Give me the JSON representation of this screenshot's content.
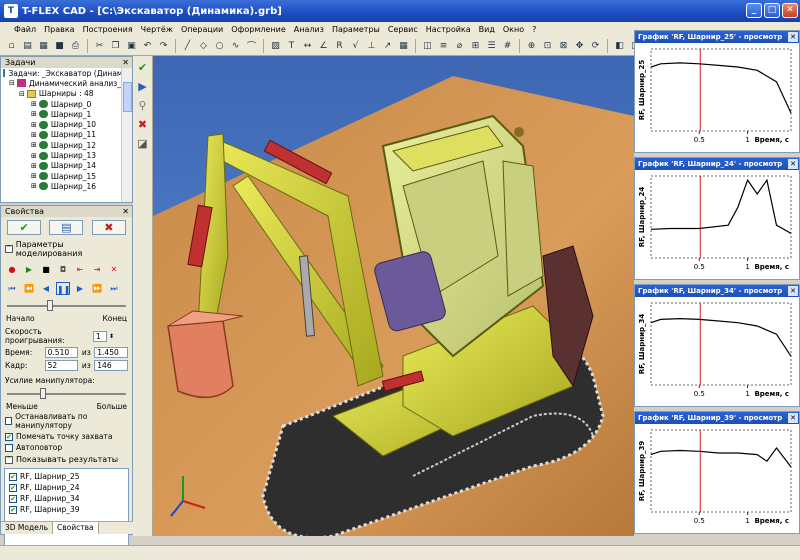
{
  "window": {
    "title": "T-FLEX CAD - [C:\\Экскаватор (Динамика).grb]",
    "app_icon": "tflex-logo-icon"
  },
  "menu": [
    "Файл",
    "Правка",
    "Построения",
    "Чертёж",
    "Операции",
    "Оформление",
    "Анализ",
    "Параметры",
    "Сервис",
    "Настройка",
    "Вид",
    "Окно",
    "?"
  ],
  "tasks_panel": {
    "title": "Задачи",
    "root": "Задачи: _Экскаватор (Динамик",
    "analysis": "Динамический анализ_0",
    "joints_folder": "Шарниры : 48",
    "joints": [
      "Шарнир_0",
      "Шарнир_1",
      "Шарнир_10",
      "Шарнир_11",
      "Шарнир_12",
      "Шарнир_13",
      "Шарнир_14",
      "Шарнир_15",
      "Шарнир_16"
    ]
  },
  "properties_panel": {
    "title": "Свойства",
    "section_sim": "Параметры моделирования",
    "start_label": "Начало",
    "end_label": "Конец",
    "speed_label": "Скорость проигрывания:",
    "speed_value": "1",
    "time_label": "Время:",
    "time_value": "0.510",
    "time_of": "из",
    "time_total": "1.450",
    "frame_label": "Кадр:",
    "frame_value": "52",
    "frame_of": "из",
    "frame_total": "146",
    "manip_label": "Усилие манипулятора:",
    "less_label": "Меньше",
    "more_label": "Больше",
    "stop_by_manip": "Останавливать по манипулятору",
    "mark_grip": "Помечать точку захвата",
    "autorepeat": "Автоповтор",
    "section_results": "Показывать результаты",
    "results": [
      "RF, Шарнир_25",
      "RF, Шарнир_24",
      "RF, Шарнир_34",
      "RF, Шарнир_39"
    ]
  },
  "tabs": [
    "3D Модель",
    "Свойства"
  ],
  "graphs": [
    {
      "title": "График 'RF, Шарнир_25' - просмотр",
      "ylabel": "RF, Шарнир_25",
      "xlabel": "Время, с",
      "ticks": [
        "0.5",
        "1"
      ]
    },
    {
      "title": "График 'RF, Шарнир_24' - просмотр",
      "ylabel": "RF, Шарнир_24",
      "xlabel": "Время, с",
      "ticks": [
        "0.5",
        "1"
      ]
    },
    {
      "title": "График 'RF, Шарнир_34' - просмотр",
      "ylabel": "RF, Шарнир_34",
      "xlabel": "Время, с",
      "ticks": [
        "0.5",
        "1"
      ]
    },
    {
      "title": "График 'RF, Шарнир_39' - просмотр",
      "ylabel": "RF, Шарнир_39",
      "xlabel": "Время, с",
      "ticks": [
        "0.5",
        "1"
      ]
    }
  ],
  "chart_data": [
    {
      "type": "line",
      "x": [
        0,
        0.1,
        0.3,
        0.5,
        0.7,
        0.9,
        1.1,
        1.3,
        1.45
      ],
      "values": [
        0.78,
        0.82,
        0.83,
        0.82,
        0.8,
        0.78,
        0.74,
        0.6,
        0.22
      ],
      "xlabel": "Время, с",
      "ylabel": "RF, Шарнир_25"
    },
    {
      "type": "line",
      "x": [
        0,
        0.2,
        0.5,
        0.8,
        0.9,
        1.0,
        1.1,
        1.2,
        1.3,
        1.45
      ],
      "values": [
        0.35,
        0.36,
        0.36,
        0.4,
        0.62,
        0.95,
        0.78,
        0.95,
        0.4,
        0.3
      ],
      "xlabel": "Время, с",
      "ylabel": "RF, Шарнир_24"
    },
    {
      "type": "line",
      "x": [
        0,
        0.1,
        0.3,
        0.5,
        0.7,
        0.9,
        1.1,
        1.3,
        1.45
      ],
      "values": [
        0.76,
        0.8,
        0.81,
        0.8,
        0.78,
        0.76,
        0.72,
        0.62,
        0.35
      ],
      "xlabel": "Время, с",
      "ylabel": "RF, Шарнир_34"
    },
    {
      "type": "line",
      "x": [
        0,
        0.1,
        0.3,
        0.5,
        0.7,
        0.9,
        1.1,
        1.2,
        1.3,
        1.45
      ],
      "values": [
        0.7,
        0.74,
        0.75,
        0.74,
        0.72,
        0.72,
        0.7,
        0.62,
        0.78,
        0.55
      ],
      "xlabel": "Время, с",
      "ylabel": "RF, Шарнир_39"
    }
  ],
  "colors": {
    "title_blue": "#1c4cc0",
    "graph_line": "#000000",
    "time_marker": "#d02020",
    "excavator_yellow": "#d8d838",
    "background_blue": "#4a78c2"
  }
}
